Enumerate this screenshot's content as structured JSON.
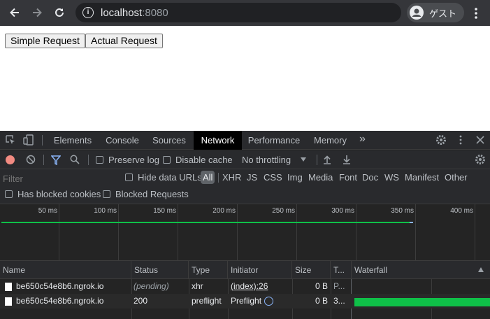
{
  "browser": {
    "url_host": "localhost",
    "url_port": ":8080",
    "profile_name": "ゲスト"
  },
  "page": {
    "buttons": [
      "Simple Request",
      "Actual Request"
    ]
  },
  "devtools": {
    "tabs": [
      "Elements",
      "Console",
      "Sources",
      "Network",
      "Performance",
      "Memory"
    ],
    "active_tab": "Network",
    "toolbar": {
      "preserve_log": "Preserve log",
      "disable_cache": "Disable cache",
      "throttling": "No throttling"
    },
    "filter": {
      "placeholder": "Filter",
      "hide_data_urls": "Hide data URLs",
      "types": [
        "All",
        "XHR",
        "JS",
        "CSS",
        "Img",
        "Media",
        "Font",
        "Doc",
        "WS",
        "Manifest",
        "Other"
      ],
      "has_blocked_cookies": "Has blocked cookies",
      "blocked_requests": "Blocked Requests"
    },
    "overview": {
      "ticks": [
        "50 ms",
        "100 ms",
        "150 ms",
        "200 ms",
        "250 ms",
        "300 ms",
        "350 ms",
        "400 ms"
      ]
    },
    "table": {
      "columns": [
        "Name",
        "Status",
        "Type",
        "Initiator",
        "Size",
        "T...",
        "Waterfall"
      ],
      "rows": [
        {
          "name": "be650c54e8b6.ngrok.io",
          "status": "(pending)",
          "type": "xhr",
          "initiator": "(index):26",
          "size": "0 B",
          "time": "P..."
        },
        {
          "name": "be650c54e8b6.ngrok.io",
          "status": "200",
          "type": "preflight",
          "initiator": "Preflight",
          "size": "0 B",
          "time": "3..."
        }
      ]
    },
    "colors": {
      "accent": "#8ab4f8",
      "record": "#f28b82",
      "waterfall_bar": "#0fc048"
    }
  }
}
